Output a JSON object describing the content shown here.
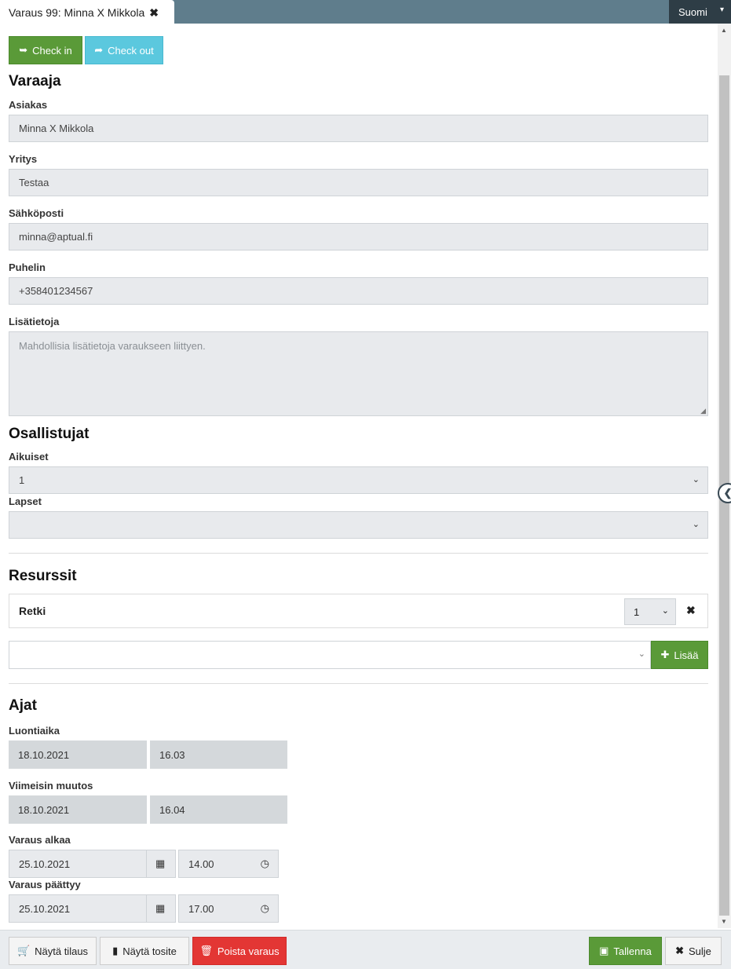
{
  "window": {
    "tab_title": "Varaus 99: Minna X Mikkola",
    "language": "Suomi"
  },
  "actions": {
    "check_in": "Check in",
    "check_out": "Check out"
  },
  "booker": {
    "heading": "Varaaja",
    "customer_label": "Asiakas",
    "customer": "Minna X Mikkola",
    "company_label": "Yritys",
    "company": "Testaa",
    "email_label": "Sähköposti",
    "email": "minna@aptual.fi",
    "phone_label": "Puhelin",
    "phone": "+358401234567",
    "notes_label": "Lisätietoja",
    "notes_placeholder": "Mahdollisia lisätietoja varaukseen liittyen."
  },
  "participants": {
    "heading": "Osallistujat",
    "adults_label": "Aikuiset",
    "adults": "1",
    "children_label": "Lapset",
    "children": ""
  },
  "resources": {
    "heading": "Resurssit",
    "items": [
      {
        "name": "Retki",
        "qty": "1"
      }
    ],
    "add_label": "Lisää"
  },
  "times": {
    "heading": "Ajat",
    "created_label": "Luontiaika",
    "created_date": "18.10.2021",
    "created_time": "16.03",
    "modified_label": "Viimeisin muutos",
    "modified_date": "18.10.2021",
    "modified_time": "16.04",
    "start_label": "Varaus alkaa",
    "start_date": "25.10.2021",
    "start_time": "14.00",
    "end_label": "Varaus päättyy",
    "end_date": "25.10.2021",
    "end_time": "17.00"
  },
  "footer": {
    "show_order": "Näytä tilaus",
    "show_receipt": "Näytä tosite",
    "delete": "Poista varaus",
    "save": "Tallenna",
    "close": "Sulje"
  }
}
